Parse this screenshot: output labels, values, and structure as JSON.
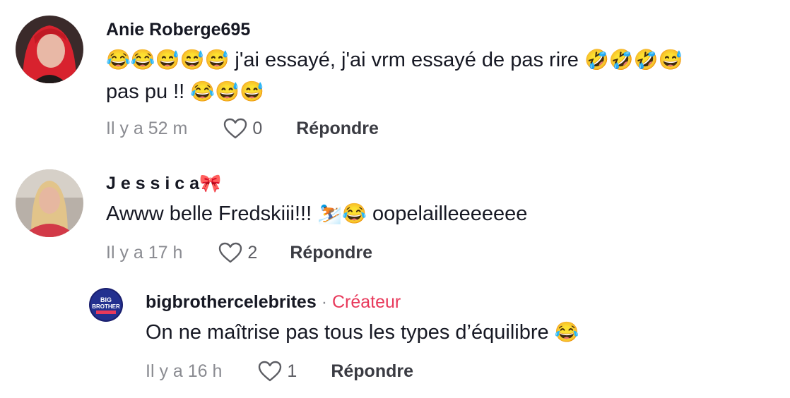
{
  "comments": [
    {
      "username": "Anie Roberge695",
      "text_line1_emoji_prefix": "😂😂😅😅😅",
      "text_line1_words": "j'ai essayé, j'ai vrm essayé de pas rire",
      "text_line1_emoji_suffix": "🤣🤣🤣😅",
      "text_line2_words": "pas pu !!",
      "text_line2_emoji": "😂😅😅",
      "time": "Il y a 52 m",
      "likes": "0",
      "reply_label": "Répondre"
    },
    {
      "username": "J e s s i c a",
      "username_emoji": "🎀",
      "text_words": "Awww belle Fredskiii!!!",
      "text_emoji": "⛷️😂",
      "text_suffix": "oopelailleeeeeee",
      "time": "Il y a 17 h",
      "likes": "2",
      "reply_label": "Répondre"
    },
    {
      "username": "bigbrothercelebrites",
      "separator": "·",
      "badge": "Créateur",
      "text_words": "On ne maîtrise pas tous les types d’équilibre",
      "text_emoji": "😂",
      "time": "Il y a 16 h",
      "likes": "1",
      "reply_label": "Répondre"
    }
  ],
  "icons": {
    "like": "heart-outline-icon"
  },
  "colors": {
    "creator_badge": "#e8395b",
    "muted_text": "#8a8b91",
    "primary_text": "#161823"
  }
}
